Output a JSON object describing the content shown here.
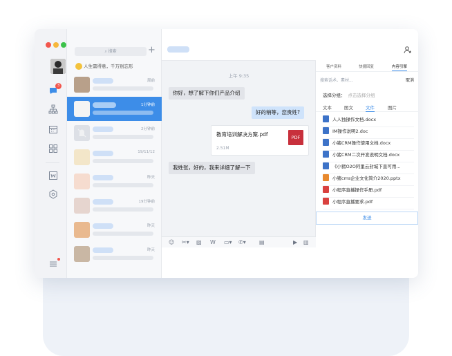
{
  "window": {
    "traffic_colors": [
      "#f2564d",
      "#f6b73c",
      "#3cc24a"
    ]
  },
  "rail": {
    "badge_count": "3",
    "icons": [
      "chat-icon",
      "org-icon",
      "calendar-icon",
      "apps-icon",
      "word-icon",
      "cube-icon",
      "menu-icon"
    ]
  },
  "list": {
    "search_placeholder": "搜索",
    "add_label": "+",
    "banner_text": "人生需得意，千万别忘形",
    "contacts": [
      {
        "time": "周前"
      },
      {
        "time": "1分钟前"
      },
      {
        "time": "2分钟前"
      },
      {
        "time": "19/11/12"
      },
      {
        "time": "昨天"
      },
      {
        "time": "19分钟前"
      },
      {
        "time": "昨天"
      },
      {
        "time": "昨天"
      }
    ]
  },
  "chat": {
    "time_label": "上午 9:35",
    "messages": [
      {
        "direction": "in",
        "text": "你好，想了解下你们产品介绍"
      },
      {
        "direction": "out",
        "text": "好的稍等，您贵姓?"
      },
      {
        "direction": "in",
        "text": "我姓张，好的，我来详细了解一下"
      }
    ],
    "file": {
      "name": "教育培训解决方案.pdf",
      "size": "2.51M",
      "badge": "PDF"
    }
  },
  "panel": {
    "tabs": [
      "客户资料",
      "快捷回复",
      "内容引擎"
    ],
    "active_tab": 2,
    "search_placeholder": "搜索话术、素材...",
    "cancel_label": "取消",
    "category_label": "选择分组：",
    "category_hint": "点击选择分组",
    "sub_tabs": [
      "文本",
      "图文",
      "文件",
      "图片"
    ],
    "active_sub_tab": 2,
    "files": [
      {
        "name": "人人独操作文档.docx",
        "type": "doc"
      },
      {
        "name": "IM操作说明2.doc",
        "type": "doc"
      },
      {
        "name": "小猪CRM操作使用文档.docx",
        "type": "doc"
      },
      {
        "name": "小猪CRM二次开发说明文档.docx",
        "type": "doc"
      },
      {
        "name": "《小猪O2O阿里云封城下直可用...",
        "type": "doc"
      },
      {
        "name": "小猪cms企业文化简介2020.pptx",
        "type": "ppt"
      },
      {
        "name": "小程序直播操作手册.pdf",
        "type": "pdf"
      },
      {
        "name": "小程序直播要求.pdf",
        "type": "pdf"
      }
    ],
    "send_label": "发送",
    "file_colors": {
      "doc": "#3d73c8",
      "ppt": "#e8892e",
      "pdf": "#d9413f"
    }
  }
}
